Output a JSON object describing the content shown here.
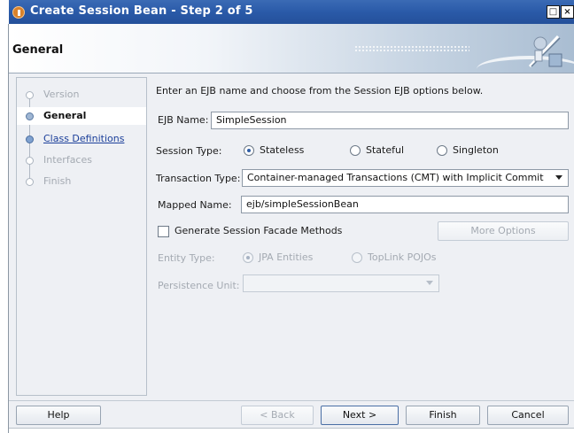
{
  "window": {
    "title": "Create Session Bean - Step 2 of 5",
    "controls": {
      "restore": "□",
      "close": "×"
    }
  },
  "header": {
    "title": "General"
  },
  "steps": [
    {
      "label": "Version",
      "state": "disabled"
    },
    {
      "label": "General",
      "state": "active"
    },
    {
      "label": "Class Definitions",
      "state": "link"
    },
    {
      "label": "Interfaces",
      "state": "disabled"
    },
    {
      "label": "Finish",
      "state": "disabled"
    }
  ],
  "form": {
    "intro": "Enter an EJB name and choose from the Session EJB options below.",
    "ejb_name": {
      "label": "EJB Name:",
      "value": "SimpleSession"
    },
    "session_type": {
      "label": "Session Type:",
      "options": [
        {
          "label": "Stateless",
          "checked": true
        },
        {
          "label": "Stateful",
          "checked": false
        },
        {
          "label": "Singleton",
          "checked": false
        }
      ]
    },
    "transaction_type": {
      "label": "Transaction Type:",
      "value": "Container-managed Transactions (CMT) with Implicit Commit"
    },
    "mapped_name": {
      "label": "Mapped Name:",
      "value": "ejb/simpleSessionBean"
    },
    "facade": {
      "label": "Generate Session Facade Methods",
      "checked": false,
      "more_options": "More Options"
    },
    "entity_type": {
      "label": "Entity Type:",
      "options": [
        {
          "label": "JPA Entities",
          "checked": true
        },
        {
          "label": "TopLink POJOs",
          "checked": false
        }
      ]
    },
    "persistence_unit": {
      "label": "Persistence Unit:",
      "value": ""
    }
  },
  "buttons": {
    "help": "Help",
    "back": "< Back",
    "next": "Next >",
    "finish": "Finish",
    "cancel": "Cancel"
  },
  "colors": {
    "titlebar": "#2a5aa8",
    "link": "#1b3f9a",
    "disabled_text": "#a4aab2"
  }
}
